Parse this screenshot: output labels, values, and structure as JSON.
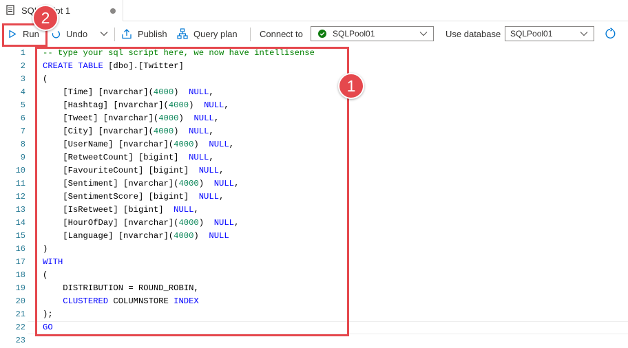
{
  "tab": {
    "title": "SQL script 1",
    "icon": "script-icon",
    "unsaved_indicator": "dot"
  },
  "toolbar": {
    "run_label": "Run",
    "undo_label": "Undo",
    "publish_label": "Publish",
    "query_plan_label": "Query plan",
    "connect_to_label": "Connect to",
    "connect_to_value": "SQLPool01",
    "use_database_label": "Use database",
    "use_database_value": "SQLPool01"
  },
  "editor": {
    "line_numbers": [
      "1",
      "2",
      "3",
      "4",
      "5",
      "6",
      "7",
      "8",
      "9",
      "10",
      "11",
      "12",
      "13",
      "14",
      "15",
      "16",
      "17",
      "18",
      "19",
      "20",
      "21",
      "22",
      "23"
    ],
    "lines": [
      [
        {
          "t": "-- type your sql script here, we now have intellisense",
          "c": "cm"
        }
      ],
      [
        {
          "t": "CREATE TABLE",
          "c": "kw"
        },
        {
          "t": " [dbo].[Twitter]",
          "c": ""
        }
      ],
      [
        {
          "t": "(",
          "c": ""
        }
      ],
      [
        {
          "t": "    [Time] [nvarchar](",
          "c": ""
        },
        {
          "t": "4000",
          "c": "num"
        },
        {
          "t": ")  ",
          "c": ""
        },
        {
          "t": "NULL",
          "c": "kw"
        },
        {
          "t": ",",
          "c": ""
        }
      ],
      [
        {
          "t": "    [Hashtag] [nvarchar](",
          "c": ""
        },
        {
          "t": "4000",
          "c": "num"
        },
        {
          "t": ")  ",
          "c": ""
        },
        {
          "t": "NULL",
          "c": "kw"
        },
        {
          "t": ",",
          "c": ""
        }
      ],
      [
        {
          "t": "    [Tweet] [nvarchar](",
          "c": ""
        },
        {
          "t": "4000",
          "c": "num"
        },
        {
          "t": ")  ",
          "c": ""
        },
        {
          "t": "NULL",
          "c": "kw"
        },
        {
          "t": ",",
          "c": ""
        }
      ],
      [
        {
          "t": "    [City] [nvarchar](",
          "c": ""
        },
        {
          "t": "4000",
          "c": "num"
        },
        {
          "t": ")  ",
          "c": ""
        },
        {
          "t": "NULL",
          "c": "kw"
        },
        {
          "t": ",",
          "c": ""
        }
      ],
      [
        {
          "t": "    [UserName] [nvarchar](",
          "c": ""
        },
        {
          "t": "4000",
          "c": "num"
        },
        {
          "t": ")  ",
          "c": ""
        },
        {
          "t": "NULL",
          "c": "kw"
        },
        {
          "t": ",",
          "c": ""
        }
      ],
      [
        {
          "t": "    [RetweetCount] [bigint]  ",
          "c": ""
        },
        {
          "t": "NULL",
          "c": "kw"
        },
        {
          "t": ",",
          "c": ""
        }
      ],
      [
        {
          "t": "    [FavouriteCount] [bigint]  ",
          "c": ""
        },
        {
          "t": "NULL",
          "c": "kw"
        },
        {
          "t": ",",
          "c": ""
        }
      ],
      [
        {
          "t": "    [Sentiment] [nvarchar](",
          "c": ""
        },
        {
          "t": "4000",
          "c": "num"
        },
        {
          "t": ")  ",
          "c": ""
        },
        {
          "t": "NULL",
          "c": "kw"
        },
        {
          "t": ",",
          "c": ""
        }
      ],
      [
        {
          "t": "    [SentimentScore] [bigint]  ",
          "c": ""
        },
        {
          "t": "NULL",
          "c": "kw"
        },
        {
          "t": ",",
          "c": ""
        }
      ],
      [
        {
          "t": "    [IsRetweet] [bigint]  ",
          "c": ""
        },
        {
          "t": "NULL",
          "c": "kw"
        },
        {
          "t": ",",
          "c": ""
        }
      ],
      [
        {
          "t": "    [HourOfDay] [nvarchar](",
          "c": ""
        },
        {
          "t": "4000",
          "c": "num"
        },
        {
          "t": ")  ",
          "c": ""
        },
        {
          "t": "NULL",
          "c": "kw"
        },
        {
          "t": ",",
          "c": ""
        }
      ],
      [
        {
          "t": "    [Language] [nvarchar](",
          "c": ""
        },
        {
          "t": "4000",
          "c": "num"
        },
        {
          "t": ")  ",
          "c": ""
        },
        {
          "t": "NULL",
          "c": "kw"
        }
      ],
      [
        {
          "t": ")",
          "c": ""
        }
      ],
      [
        {
          "t": "WITH",
          "c": "kw"
        }
      ],
      [
        {
          "t": "(",
          "c": ""
        }
      ],
      [
        {
          "t": "    DISTRIBUTION = ROUND_ROBIN,",
          "c": ""
        }
      ],
      [
        {
          "t": "    ",
          "c": ""
        },
        {
          "t": "CLUSTERED",
          "c": "kw"
        },
        {
          "t": " COLUMNSTORE ",
          "c": ""
        },
        {
          "t": "INDEX",
          "c": "kw"
        }
      ],
      [
        {
          "t": ");",
          "c": ""
        }
      ],
      [
        {
          "t": "GO",
          "c": "kw"
        }
      ],
      []
    ]
  },
  "annotations": {
    "badge_1": "1",
    "badge_2": "2"
  },
  "colors": {
    "highlight": "#e5484d",
    "keyword": "#0000ff",
    "number": "#098658",
    "comment": "#008000",
    "connected": "#107c10"
  }
}
